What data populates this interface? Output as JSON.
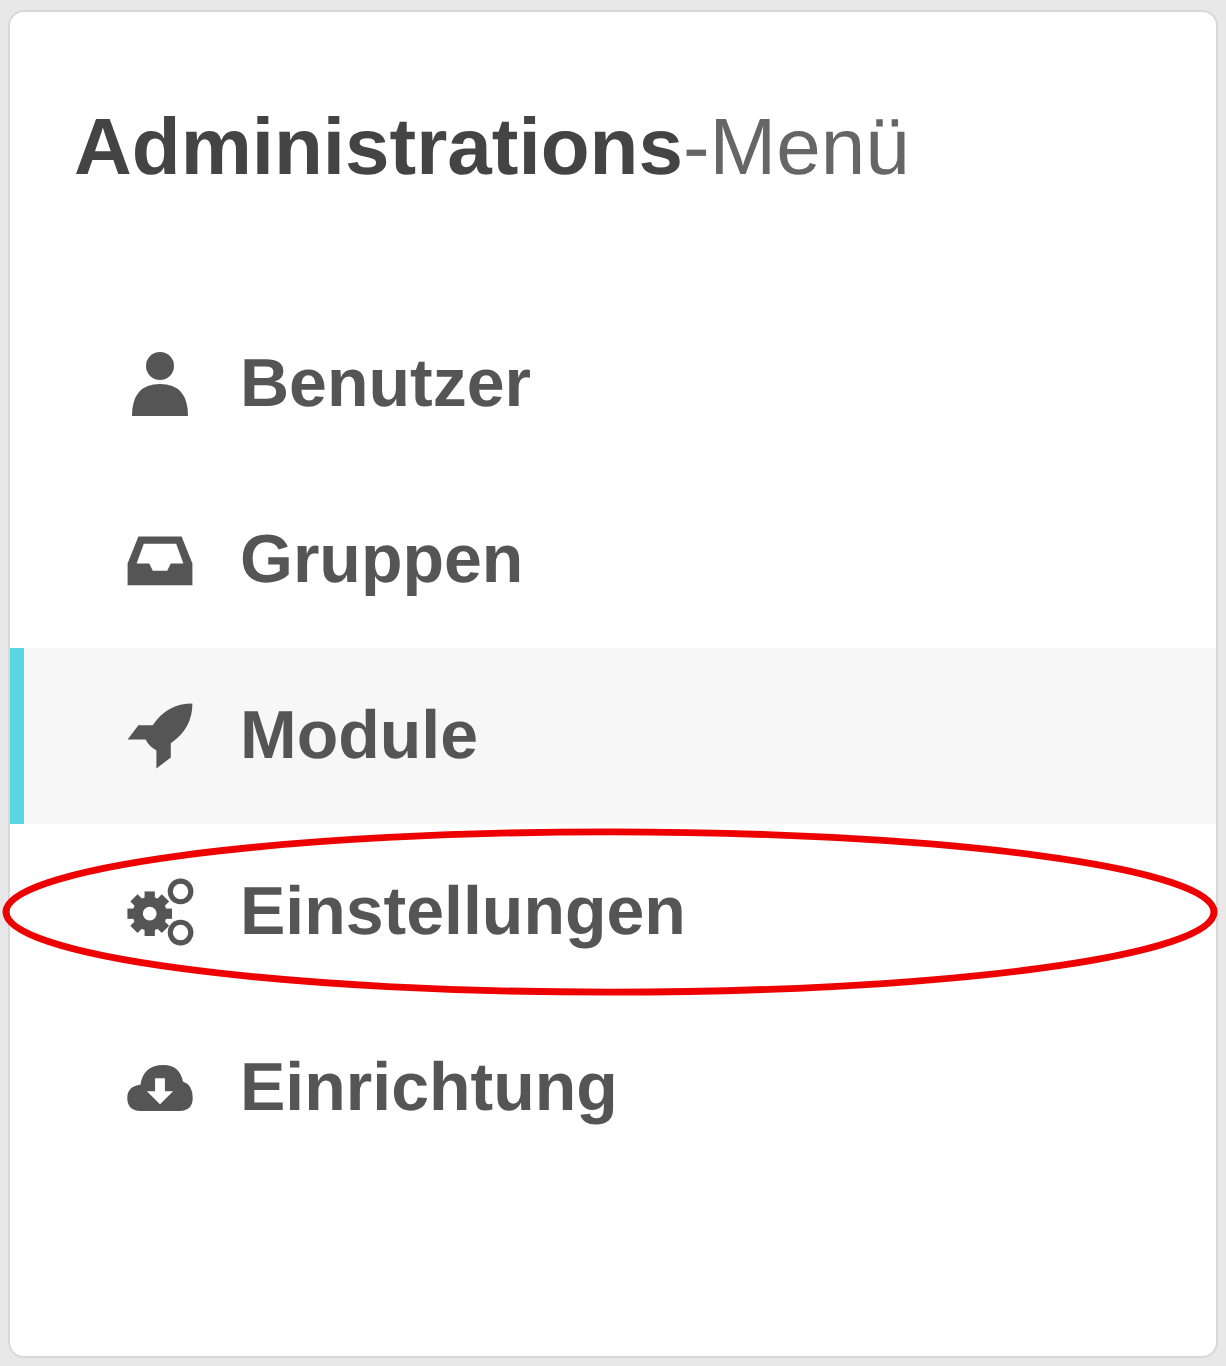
{
  "menu": {
    "title": "**Administrations**-Menü",
    "items": [
      {
        "label": "Benutzer",
        "kind": "user",
        "selected": false,
        "circled": false
      },
      {
        "label": "Gruppen",
        "kind": "inbox",
        "selected": false,
        "circled": false
      },
      {
        "label": "Module",
        "kind": "rocket",
        "selected": true,
        "circled": false
      },
      {
        "label": "Einstellungen",
        "kind": "gears",
        "selected": false,
        "circled": true
      },
      {
        "label": "Einrichtung",
        "kind": "cloud",
        "selected": false,
        "circled": false
      }
    ]
  }
}
